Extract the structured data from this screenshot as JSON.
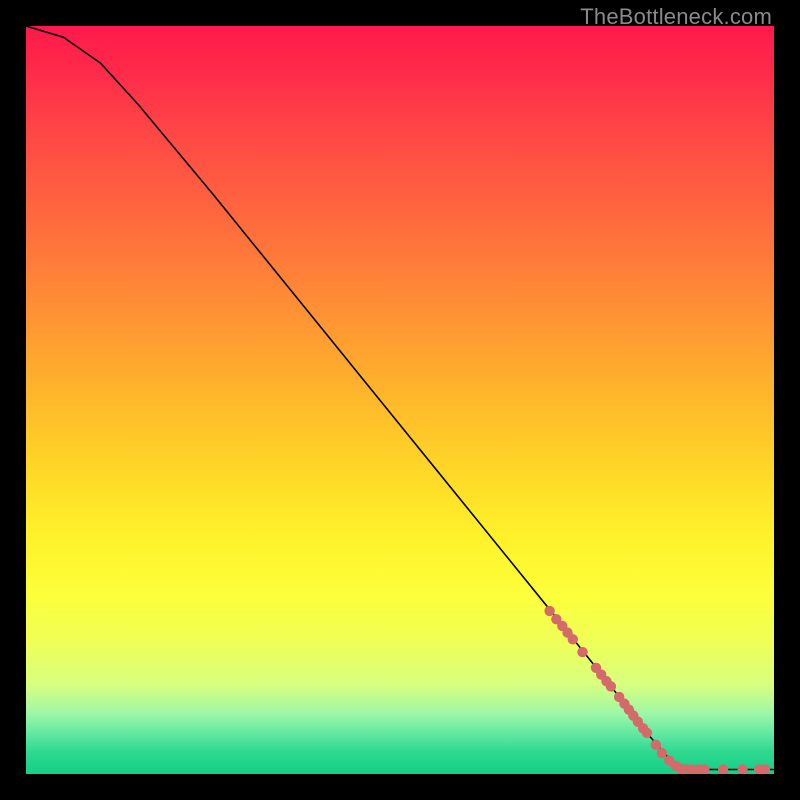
{
  "watermark": "TheBottleneck.com",
  "colors": {
    "dot": "#d46a6a",
    "curve": "#000000"
  },
  "chart_data": {
    "type": "line",
    "title": "",
    "xlabel": "",
    "ylabel": "",
    "xlim": [
      0,
      100
    ],
    "ylim": [
      0,
      100
    ],
    "grid": false,
    "legend": false,
    "curve": [
      {
        "x": 0,
        "y": 100
      },
      {
        "x": 5,
        "y": 98.5
      },
      {
        "x": 10,
        "y": 95
      },
      {
        "x": 15,
        "y": 89.5
      },
      {
        "x": 25,
        "y": 77.5
      },
      {
        "x": 40,
        "y": 59
      },
      {
        "x": 55,
        "y": 40.5
      },
      {
        "x": 70,
        "y": 22
      },
      {
        "x": 78,
        "y": 12
      },
      {
        "x": 83,
        "y": 5.5
      },
      {
        "x": 86,
        "y": 2.0
      },
      {
        "x": 88,
        "y": 0.6
      },
      {
        "x": 100,
        "y": 0.6
      }
    ],
    "points": [
      {
        "x": 70.0,
        "y": 21.8
      },
      {
        "x": 70.9,
        "y": 20.7
      },
      {
        "x": 71.7,
        "y": 19.8
      },
      {
        "x": 72.4,
        "y": 18.9
      },
      {
        "x": 73.1,
        "y": 18.0
      },
      {
        "x": 74.4,
        "y": 16.3
      },
      {
        "x": 76.2,
        "y": 14.2
      },
      {
        "x": 76.9,
        "y": 13.3
      },
      {
        "x": 77.6,
        "y": 12.4
      },
      {
        "x": 78.2,
        "y": 11.7
      },
      {
        "x": 79.3,
        "y": 10.3
      },
      {
        "x": 80.0,
        "y": 9.4
      },
      {
        "x": 80.6,
        "y": 8.6
      },
      {
        "x": 81.2,
        "y": 7.8
      },
      {
        "x": 81.8,
        "y": 7.0
      },
      {
        "x": 82.5,
        "y": 6.1
      },
      {
        "x": 83.0,
        "y": 5.5
      },
      {
        "x": 84.2,
        "y": 3.9
      },
      {
        "x": 85.0,
        "y": 2.8
      },
      {
        "x": 86.0,
        "y": 1.8
      },
      {
        "x": 86.8,
        "y": 1.1
      },
      {
        "x": 87.6,
        "y": 0.7
      },
      {
        "x": 88.4,
        "y": 0.6
      },
      {
        "x": 89.1,
        "y": 0.6
      },
      {
        "x": 90.0,
        "y": 0.6
      },
      {
        "x": 90.7,
        "y": 0.6
      },
      {
        "x": 93.2,
        "y": 0.6
      },
      {
        "x": 95.8,
        "y": 0.6
      },
      {
        "x": 98.0,
        "y": 0.6
      },
      {
        "x": 98.8,
        "y": 0.6
      }
    ],
    "dot_radius": 5.2
  }
}
